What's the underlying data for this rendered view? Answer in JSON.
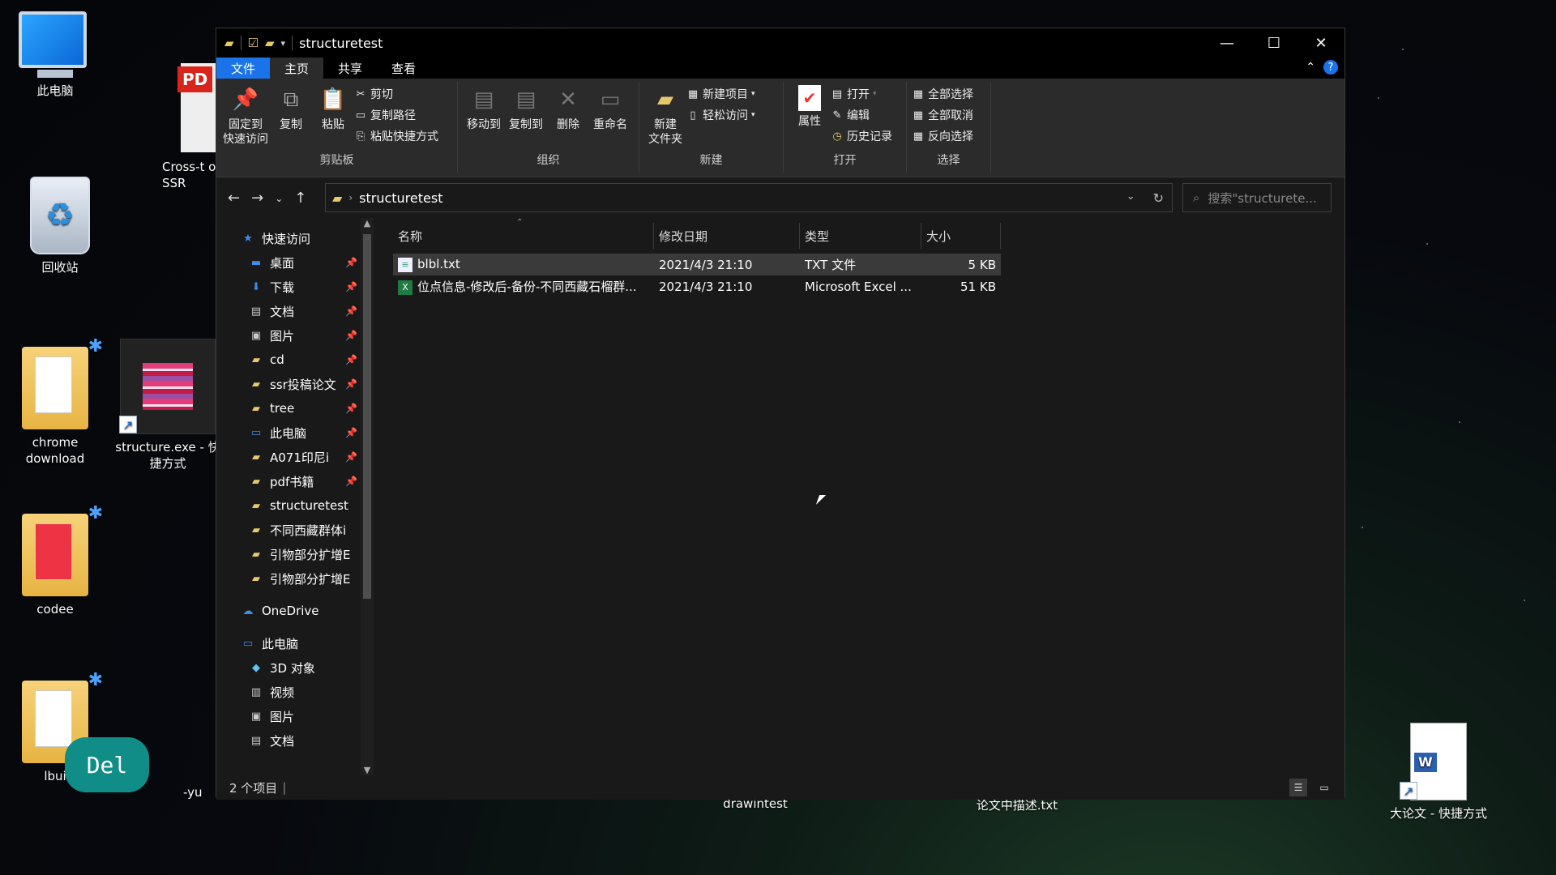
{
  "desktop": {
    "icons": [
      {
        "label": "此电脑"
      },
      {
        "label": "回收站"
      },
      {
        "label": "Cross-t of SSR"
      },
      {
        "label": "chrome download"
      },
      {
        "label": "structure.exe - 快捷方式"
      },
      {
        "label": "codee"
      },
      {
        "label": "lbui"
      },
      {
        "label": "-yu"
      },
      {
        "label": "drawintest"
      },
      {
        "label": "论文中描述.txt"
      },
      {
        "label": "大论文 - 快捷方式"
      }
    ],
    "del_button": "Del"
  },
  "window": {
    "title": "structuretest",
    "tabs": [
      "文件",
      "主页",
      "共享",
      "查看"
    ],
    "ribbon": {
      "clipboard": {
        "label": "剪贴板",
        "pin": "固定到\n快速访问",
        "copy": "复制",
        "paste": "粘贴",
        "cut": "剪切",
        "copy_path": "复制路径",
        "paste_shortcut": "粘贴快捷方式"
      },
      "organize": {
        "label": "组织",
        "move_to": "移动到",
        "copy_to": "复制到",
        "delete": "删除",
        "rename": "重命名"
      },
      "new": {
        "label": "新建",
        "new_folder": "新建\n文件夹",
        "new_item": "新建项目",
        "easy_access": "轻松访问"
      },
      "open": {
        "label": "打开",
        "properties": "属性",
        "open": "打开",
        "edit": "编辑",
        "history": "历史记录"
      },
      "select": {
        "label": "选择",
        "select_all": "全部选择",
        "select_none": "全部取消",
        "invert": "反向选择"
      }
    },
    "address": {
      "path": "structuretest",
      "search_placeholder": "搜索\"structurete..."
    },
    "sidebar": {
      "quick_access": "快速访问",
      "items": [
        {
          "label": "桌面",
          "icon": "desktop-icon",
          "pinned": true
        },
        {
          "label": "下载",
          "icon": "download-icon",
          "pinned": true
        },
        {
          "label": "文档",
          "icon": "document-icon",
          "pinned": true
        },
        {
          "label": "图片",
          "icon": "picture-icon",
          "pinned": true
        },
        {
          "label": "cd",
          "icon": "folder-icon",
          "pinned": true
        },
        {
          "label": "ssr投稿论文",
          "icon": "folder-icon",
          "pinned": true
        },
        {
          "label": "tree",
          "icon": "folder-icon",
          "pinned": true
        },
        {
          "label": "此电脑",
          "icon": "pc-icon",
          "pinned": true
        },
        {
          "label": "A071印尼i",
          "icon": "folder-icon",
          "pinned": true
        },
        {
          "label": "pdf书籍",
          "icon": "folder-icon",
          "pinned": true
        },
        {
          "label": "structuretest",
          "icon": "folder-icon",
          "pinned": false
        },
        {
          "label": "不同西藏群体i",
          "icon": "folder-icon",
          "pinned": false
        },
        {
          "label": "引物部分扩增E",
          "icon": "folder-icon",
          "pinned": false
        },
        {
          "label": "引物部分扩增E",
          "icon": "folder-icon",
          "pinned": false
        }
      ],
      "onedrive": "OneDrive",
      "this_pc": "此电脑",
      "pc_items": [
        {
          "label": "3D 对象",
          "icon": "3d-icon"
        },
        {
          "label": "视频",
          "icon": "video-icon"
        },
        {
          "label": "图片",
          "icon": "picture-icon"
        },
        {
          "label": "文档",
          "icon": "document-icon"
        }
      ]
    },
    "columns": [
      "名称",
      "修改日期",
      "类型",
      "大小"
    ],
    "files": [
      {
        "name": "blbl.txt",
        "date": "2021/4/3 21:10",
        "type": "TXT 文件",
        "size": "5 KB"
      },
      {
        "name": "位点信息-修改后-备份-不同西藏石榴群...",
        "date": "2021/4/3 21:10",
        "type": "Microsoft Excel ...",
        "size": "51 KB"
      }
    ],
    "status": "2 个项目"
  }
}
